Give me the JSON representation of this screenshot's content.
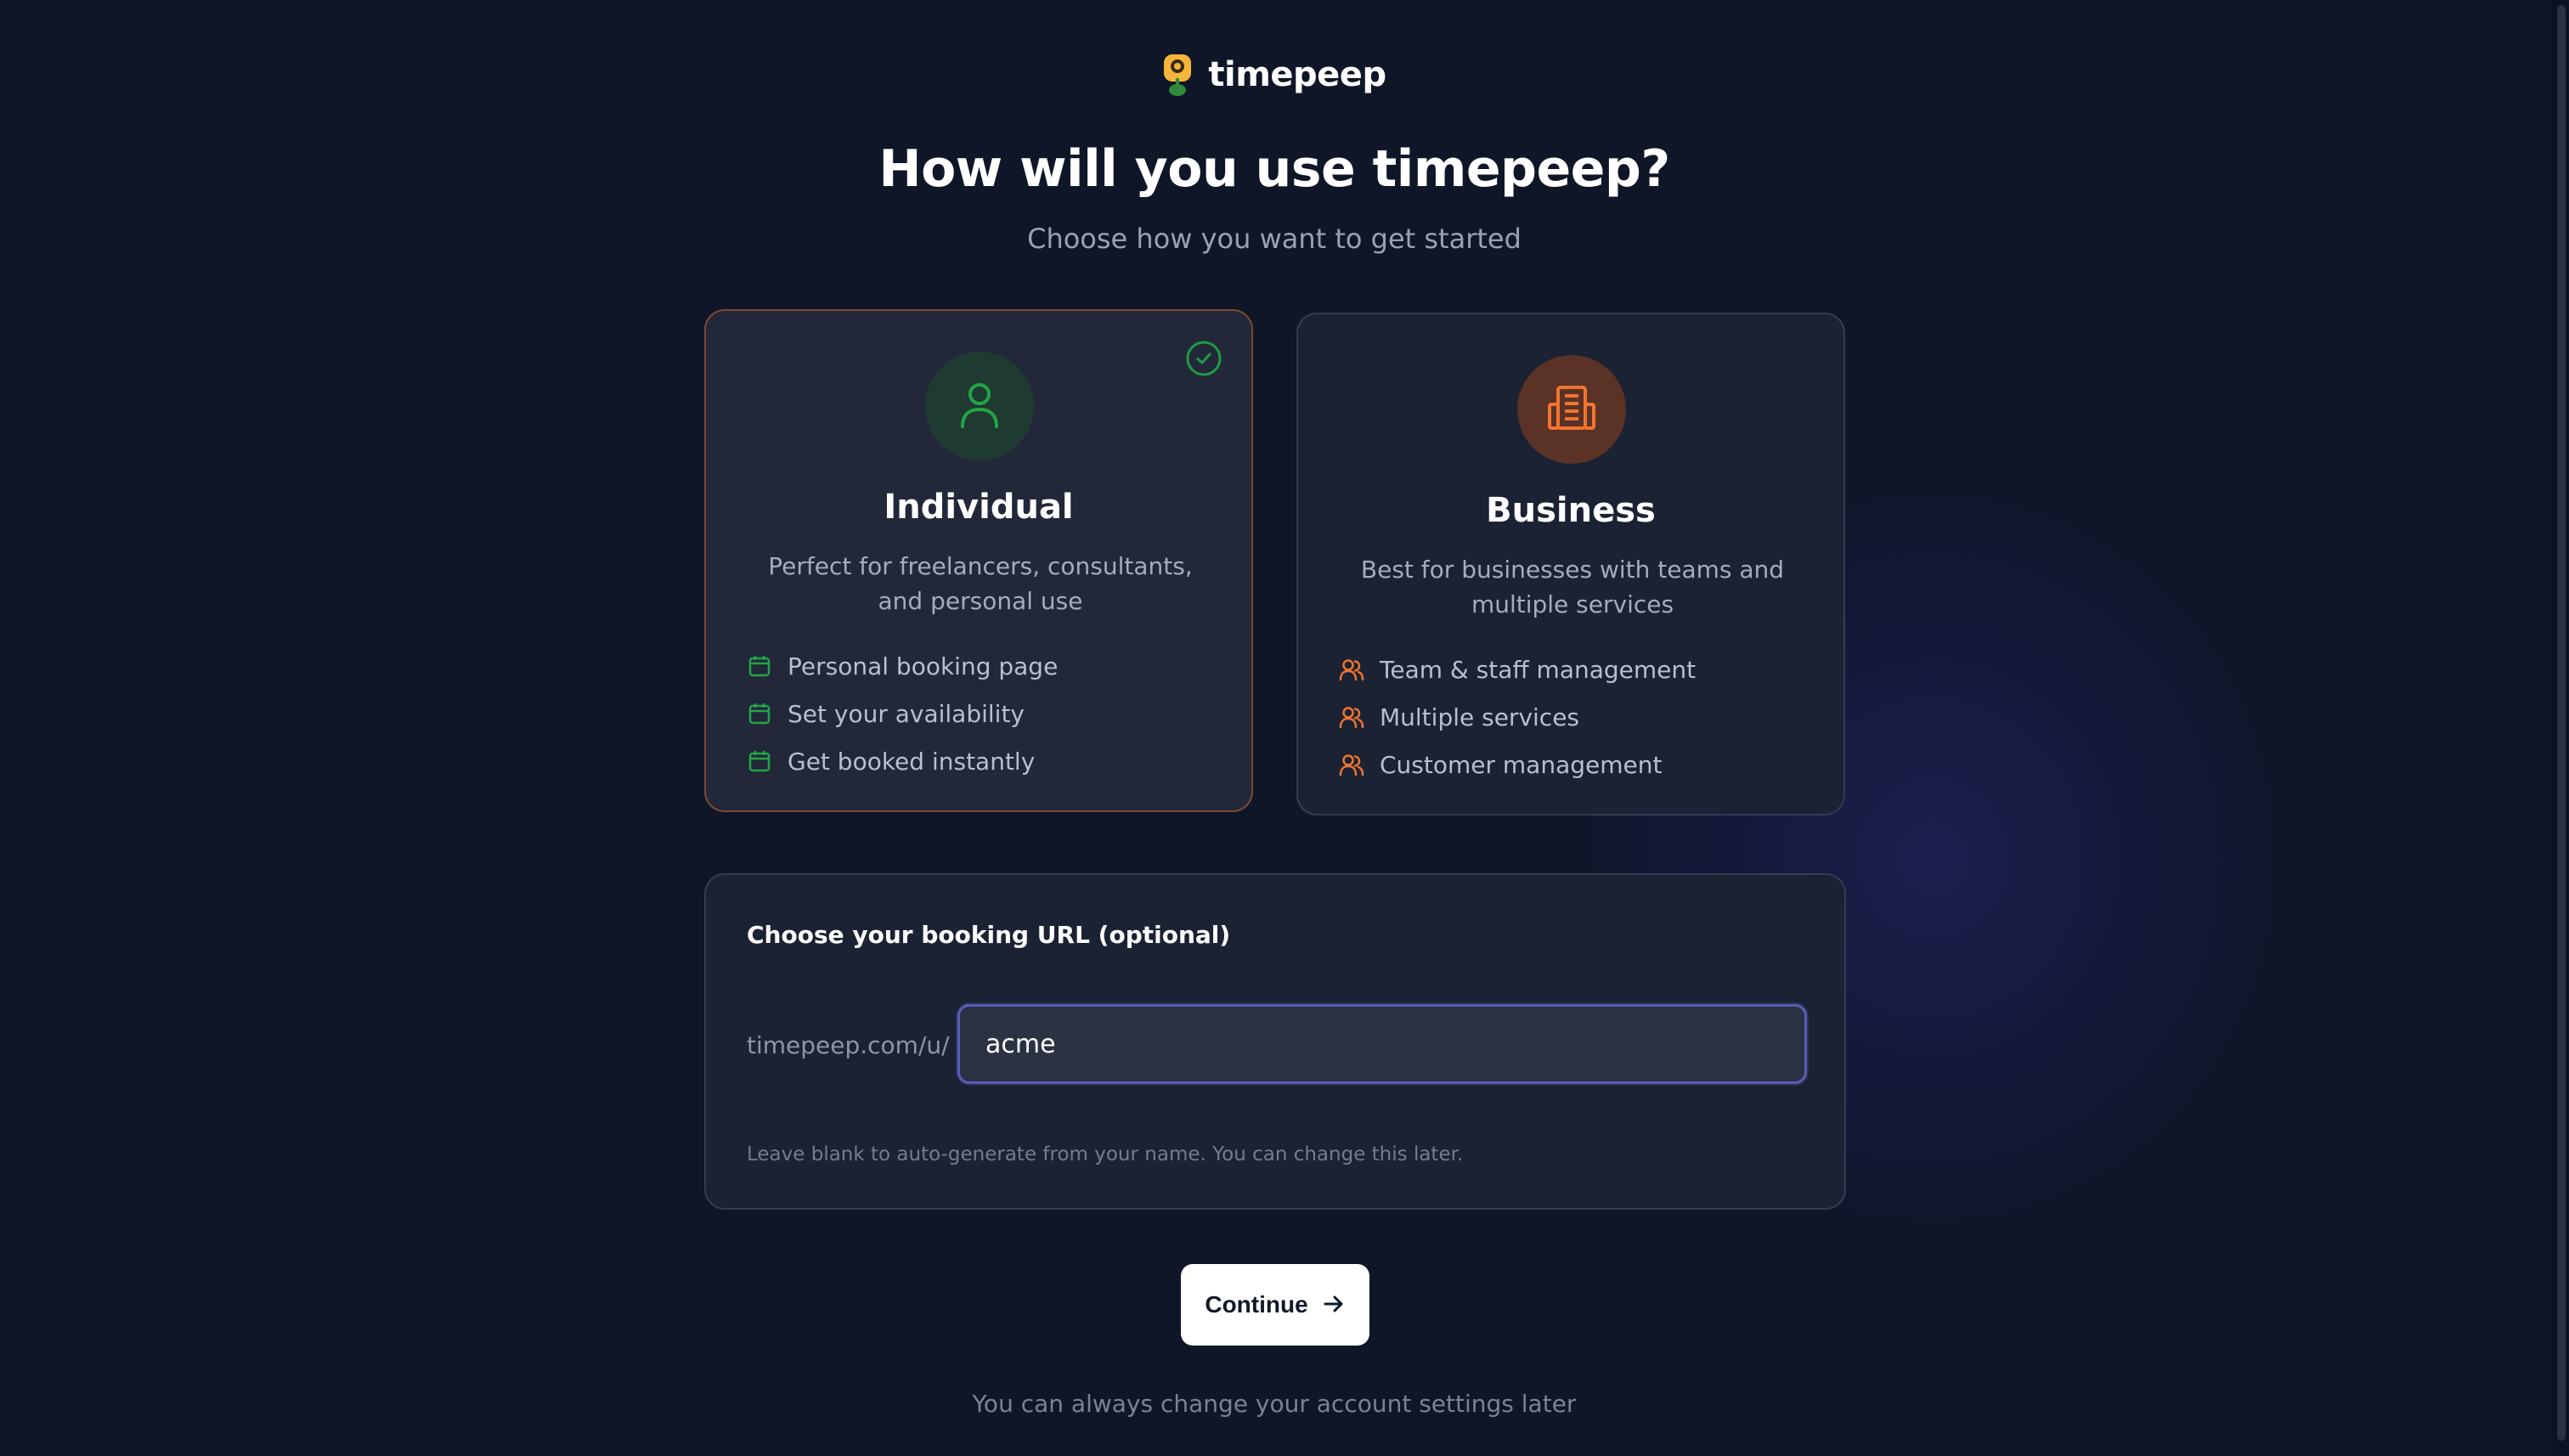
{
  "brand": {
    "name": "timepeep",
    "logo_icon": "sunflower-logo-icon"
  },
  "heading": {
    "title": "How will you use timepeep?",
    "subtitle": "Choose how you want to get started"
  },
  "options": {
    "individual": {
      "title": "Individual",
      "description": "Perfect for freelancers, consultants, and personal use",
      "icon": "user-icon",
      "selected": true,
      "accent_color": "#22a447",
      "features": [
        {
          "label": "Personal booking page",
          "icon": "calendar-icon"
        },
        {
          "label": "Set your availability",
          "icon": "calendar-icon"
        },
        {
          "label": "Get booked instantly",
          "icon": "calendar-icon"
        }
      ]
    },
    "business": {
      "title": "Business",
      "description": "Best for businesses with teams and multiple services",
      "icon": "building-icon",
      "selected": false,
      "accent_color": "#f0742f",
      "features": [
        {
          "label": "Team & staff management",
          "icon": "users-icon"
        },
        {
          "label": "Multiple services",
          "icon": "users-icon"
        },
        {
          "label": "Customer management",
          "icon": "users-icon"
        }
      ]
    }
  },
  "booking_url": {
    "label": "Choose your booking URL (optional)",
    "prefix": "timepeep.com/u/",
    "value": "acme",
    "hint": "Leave blank to auto-generate from your name. You can change this later."
  },
  "continue_button": {
    "label": "Continue",
    "icon": "arrow-right-icon"
  },
  "footnote": "You can always change your account settings later"
}
